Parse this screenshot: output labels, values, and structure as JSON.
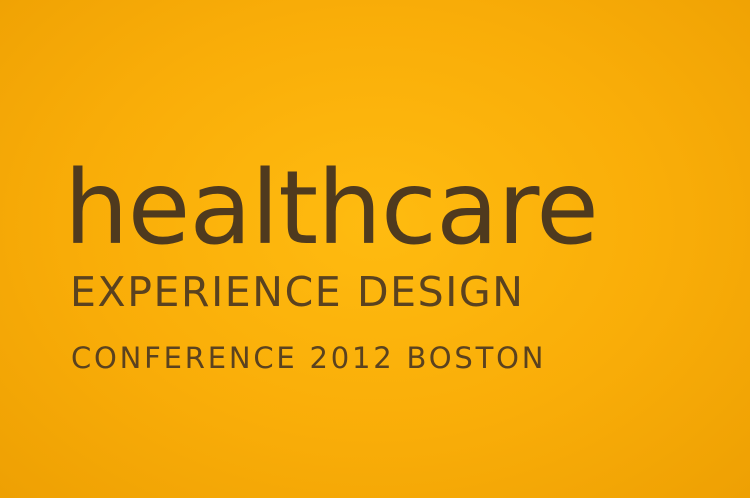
{
  "sign": {
    "title": "healthcare",
    "subtitle": "EXPERIENCE DESIGN",
    "tagline": "CONFERENCE 2012 BOSTON"
  },
  "colors": {
    "background": "#f9ad08",
    "text": "#4f3a1e"
  }
}
